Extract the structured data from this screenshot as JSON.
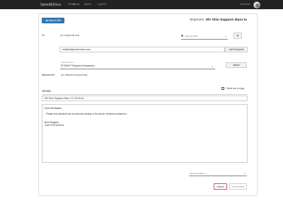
{
  "navbar": {
    "brand": "SpeedEDocs",
    "links": [
      "Home",
      "About",
      "Admin",
      "LogOut"
    ],
    "user": "Test User"
  },
  "toolbar": {
    "back_label": "Back to Bill"
  },
  "shipment": {
    "prefix": "Shipment",
    "name": "MV Shin Sapparo Maru to"
  },
  "recipients": {
    "to_label": "To",
    "placeholder_text": "(no recipients set)",
    "address_book_label": "Address Book",
    "add_plus_label": "+",
    "email_value": "info@cadportservices.com",
    "add_recipient_label": "Add Recipient"
  },
  "documents": {
    "select_caption": "Select Document",
    "selected_document": "DRAFT Shippers Declaration",
    "attach_label": "Attach",
    "attachment_label": "Attachment",
    "attachment_value": "(no attached documents)"
  },
  "email": {
    "title": "Email",
    "send_copy_label": "Send me a copy",
    "subject": "MV Shin Sapparo Maru, N 1 06 Exdc",
    "body_lines": [
      "Dear Sir/Madam,",
      "Please find attached the documents relating to the above mentioned shipment.",
      "Best Regards,",
      "Cadi Port Services"
    ],
    "signature_label": "Signature Block",
    "cancel_label": "Cancel",
    "send_label": "Send Email"
  }
}
